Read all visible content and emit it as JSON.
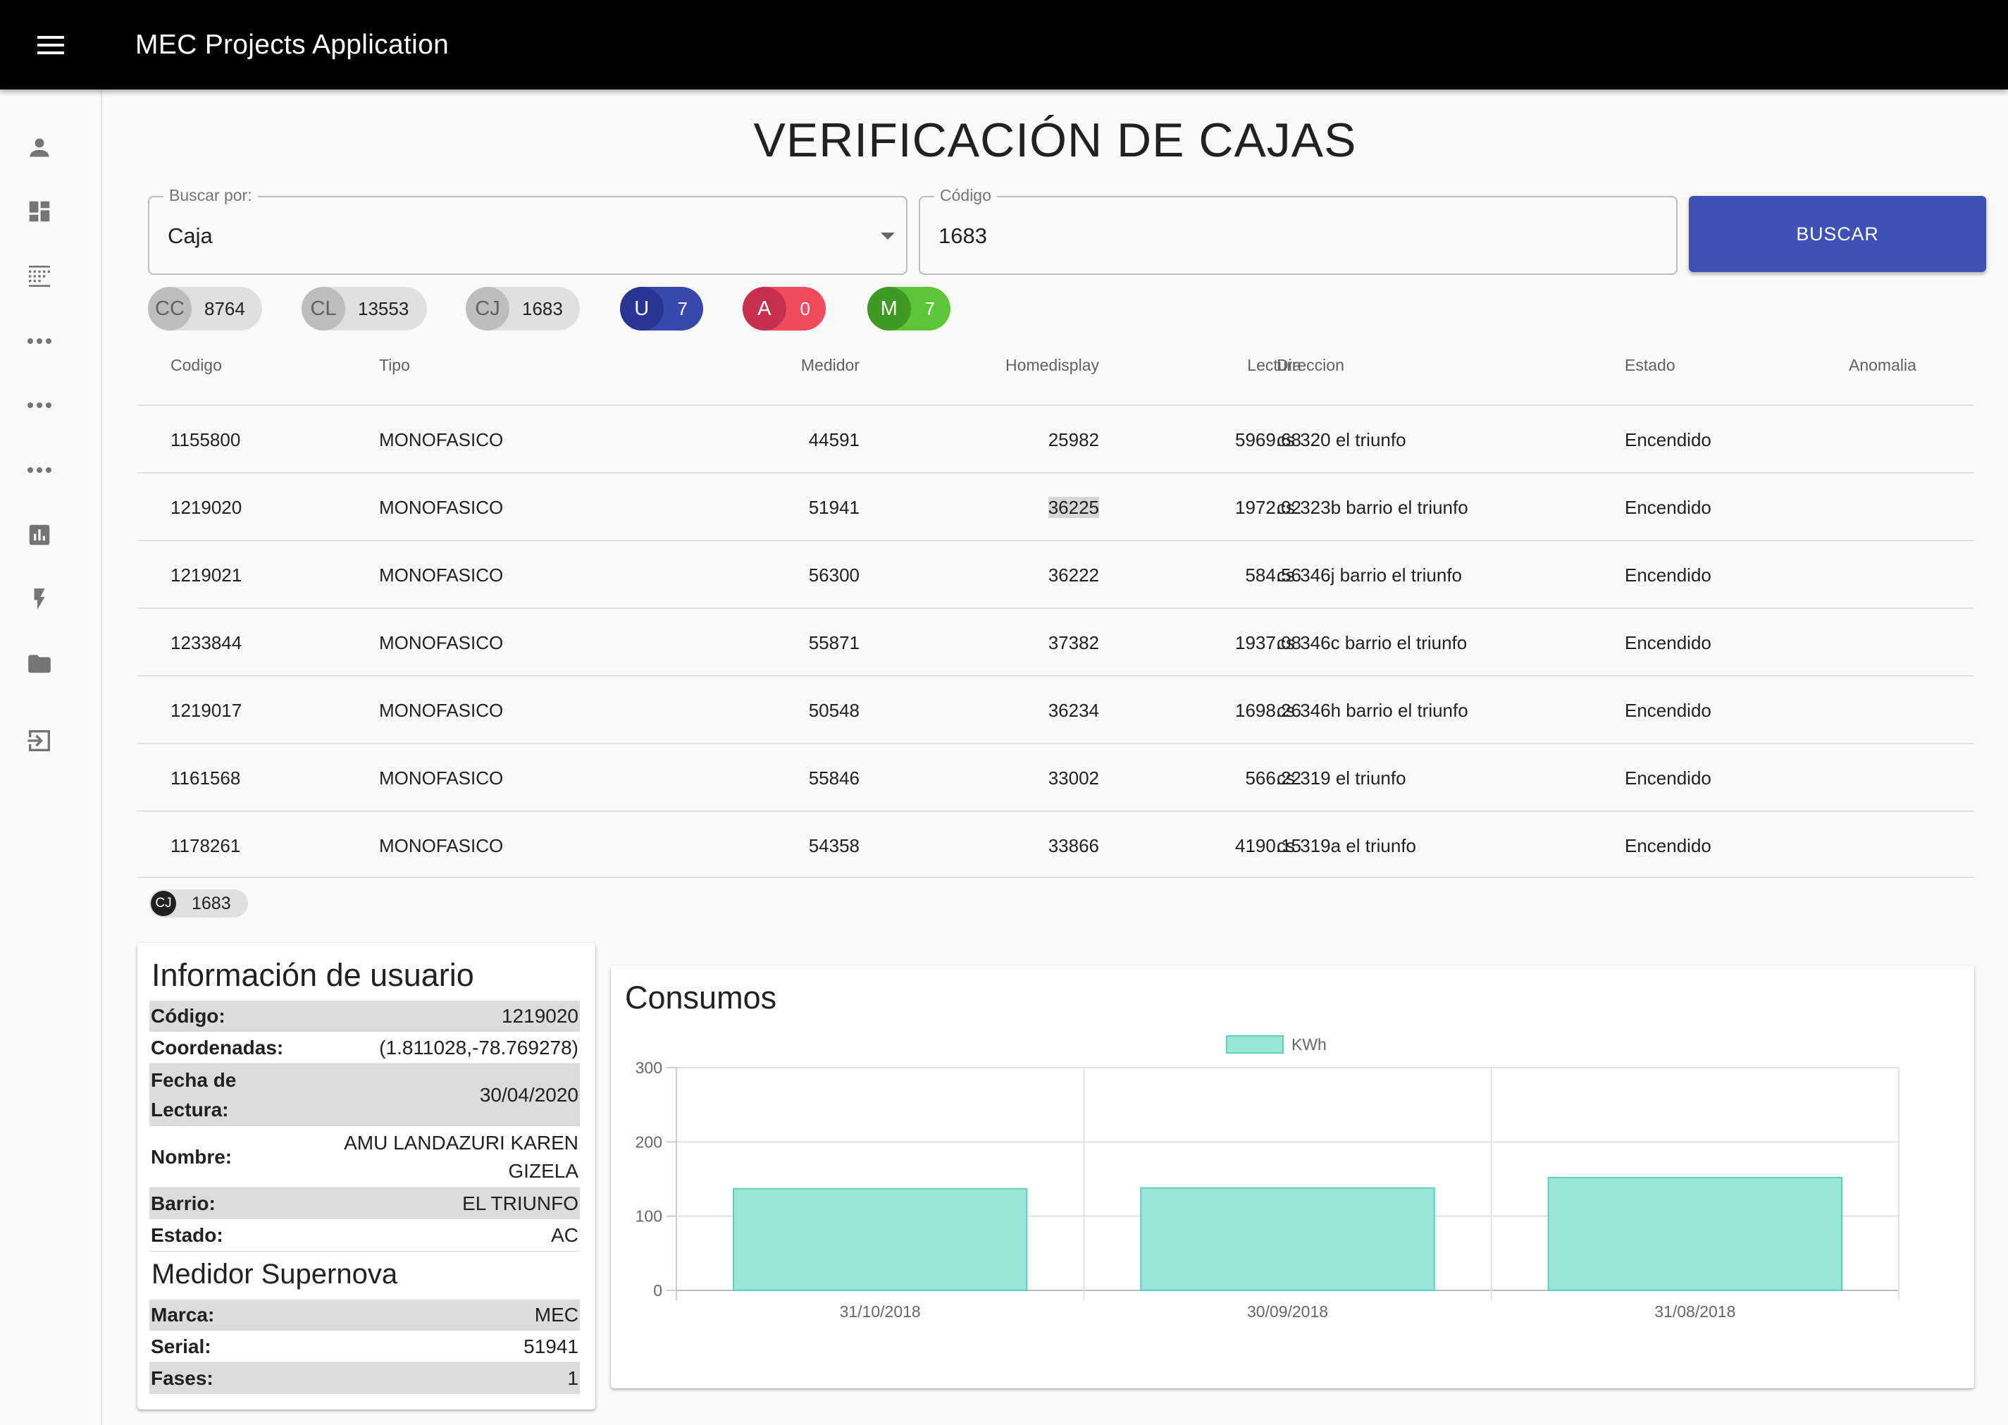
{
  "app": {
    "title": "MEC Projects Application"
  },
  "sidebar": {
    "items": [
      "person-icon",
      "dashboard-icon",
      "grid-icon",
      "more-icon",
      "more-icon",
      "more-icon",
      "bar-chart-icon",
      "flash-icon",
      "folder-icon",
      "exit-icon"
    ]
  },
  "page": {
    "title": "VERIFICACIÓN DE CAJAS"
  },
  "search": {
    "by_label": "Buscar por:",
    "by_value": "Caja",
    "code_label": "Código",
    "code_value": "1683",
    "button_label": "BUSCAR"
  },
  "chips": [
    {
      "avatar": "CC",
      "value": "8764"
    },
    {
      "avatar": "CL",
      "value": "13553"
    },
    {
      "avatar": "CJ",
      "value": "1683"
    },
    {
      "avatar": "U",
      "value": "7"
    },
    {
      "avatar": "A",
      "value": "0"
    },
    {
      "avatar": "M",
      "value": "7"
    }
  ],
  "colors": {
    "accent": "#3f51b5",
    "chip_u": "#3949ab",
    "chip_a": "#f04c5c",
    "chip_m": "#5cc638",
    "bar_fill": "#9ae6d8",
    "bar_stroke": "#5fcfbd"
  },
  "table": {
    "headers": {
      "codigo": "Codigo",
      "tipo": "Tipo",
      "medidor": "Medidor",
      "homedisplay": "Homedisplay",
      "lectura": "Lectura",
      "direccion": "Direccion",
      "estado": "Estado",
      "anomalia": "Anomalia"
    },
    "rows": [
      {
        "codigo": "1155800",
        "tipo": "MONOFASICO",
        "medidor": "44591",
        "homedisplay": "25982",
        "lectura": "5969.68",
        "direccion": "cs 320 el triunfo",
        "estado": "Encendido",
        "anomalia": ""
      },
      {
        "codigo": "1219020",
        "tipo": "MONOFASICO",
        "medidor": "51941",
        "homedisplay": "36225",
        "lectura": "1972.02",
        "direccion": "cs 323b barrio el triunfo",
        "estado": "Encendido",
        "anomalia": ""
      },
      {
        "codigo": "1219021",
        "tipo": "MONOFASICO",
        "medidor": "56300",
        "homedisplay": "36222",
        "lectura": "584.56",
        "direccion": "cs 346j barrio el triunfo",
        "estado": "Encendido",
        "anomalia": ""
      },
      {
        "codigo": "1233844",
        "tipo": "MONOFASICO",
        "medidor": "55871",
        "homedisplay": "37382",
        "lectura": "1937.08",
        "direccion": "cs 346c barrio el triunfo",
        "estado": "Encendido",
        "anomalia": ""
      },
      {
        "codigo": "1219017",
        "tipo": "MONOFASICO",
        "medidor": "50548",
        "homedisplay": "36234",
        "lectura": "1698.26",
        "direccion": "cs 346h barrio el triunfo",
        "estado": "Encendido",
        "anomalia": ""
      },
      {
        "codigo": "1161568",
        "tipo": "MONOFASICO",
        "medidor": "55846",
        "homedisplay": "33002",
        "lectura": "566.22",
        "direccion": "cs 319 el triunfo",
        "estado": "Encendido",
        "anomalia": ""
      },
      {
        "codigo": "1178261",
        "tipo": "MONOFASICO",
        "medidor": "54358",
        "homedisplay": "33866",
        "lectura": "4190.15",
        "direccion": "cs 319a el triunfo",
        "estado": "Encendido",
        "anomalia": ""
      }
    ]
  },
  "selected_chip": {
    "avatar": "CJ",
    "value": "1683"
  },
  "user_info": {
    "title": "Información de usuario",
    "codigo_label": "Código:",
    "codigo": "1219020",
    "coordenadas_label": "Coordenadas:",
    "coordenadas": "(1.811028,-78.769278)",
    "fecha_label_1": "Fecha de",
    "fecha_label_2": "Lectura:",
    "fecha": "30/04/2020",
    "nombre_label": "Nombre:",
    "nombre_1": "AMU LANDAZURI KAREN",
    "nombre_2": "GIZELA",
    "barrio_label": "Barrio:",
    "barrio": "EL TRIUNFO",
    "estado_label": "Estado:",
    "estado": "AC"
  },
  "medidor": {
    "title": "Medidor Supernova",
    "marca_label": "Marca:",
    "marca": "MEC",
    "serial_label": "Serial:",
    "serial": "51941",
    "fases_label": "Fases:",
    "fases": "1"
  },
  "chart_card": {
    "title": "Consumos"
  },
  "chart_data": {
    "type": "bar",
    "title": "",
    "categories": [
      "31/10/2018",
      "30/09/2018",
      "31/08/2018"
    ],
    "series": [
      {
        "name": "KWh",
        "values": [
          137,
          138,
          152
        ]
      }
    ],
    "ylim": [
      0,
      300
    ],
    "yticks": [
      0,
      100,
      200,
      300
    ],
    "grid": true,
    "legend": "top"
  }
}
